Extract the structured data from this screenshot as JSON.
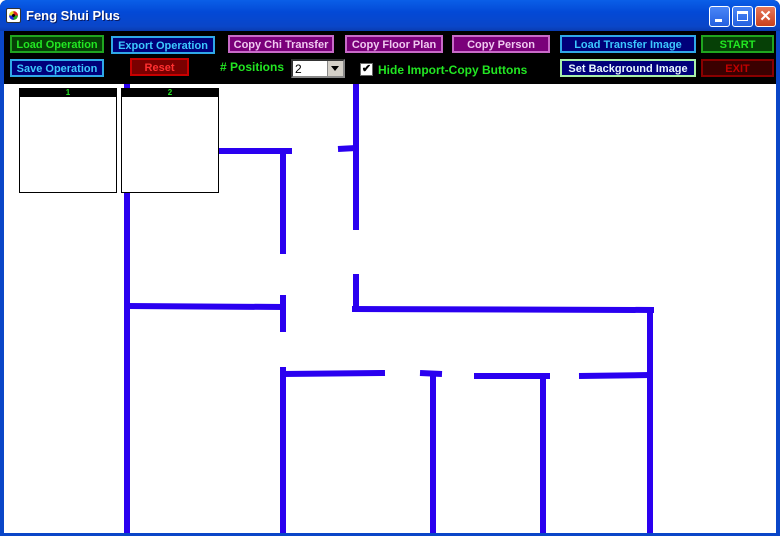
{
  "window": {
    "title": "Feng Shui Plus",
    "controls": {
      "minimize": "minimize-icon",
      "maximize": "maximize-icon",
      "close": "close-icon",
      "close_glyph": "✕"
    }
  },
  "toolbar": {
    "load_operation": "Load Operation",
    "save_operation": "Save Operation",
    "export_operation": "Export Operation",
    "reset": "Reset",
    "copy_chi_transfer": "Copy Chi Transfer",
    "copy_floor_plan": "Copy Floor Plan",
    "copy_person": "Copy Person",
    "load_transfer_image": "Load Transfer Image",
    "set_background_image": "Set Background Image",
    "start": "START",
    "exit": "EXIT",
    "positions_label": "# Positions",
    "positions_value": "2",
    "hide_import_copy_label": "Hide Import-Copy Buttons",
    "hide_import_copy_checked": "✔"
  },
  "positions": [
    {
      "label": "1"
    },
    {
      "label": "2"
    }
  ],
  "colors": {
    "wall": "#2a00f0",
    "accent_green": "#22e622"
  }
}
